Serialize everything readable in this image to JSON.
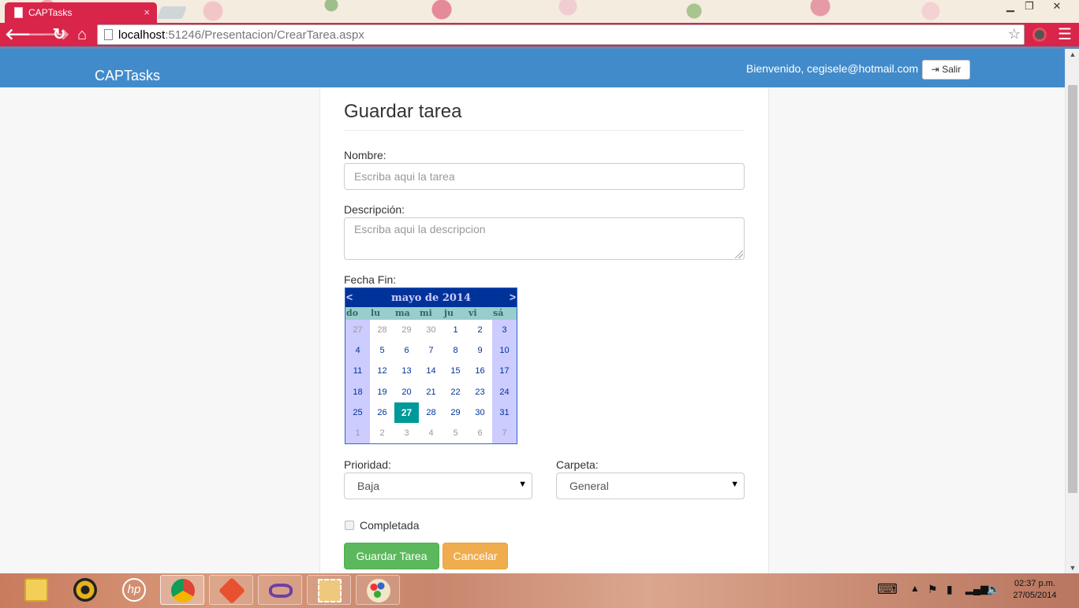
{
  "browser": {
    "tab_title": "CAPTasks",
    "tab_close": "×",
    "url_host": "localhost",
    "url_path": ":51246/Presentacion/CrearTarea.aspx",
    "window_min": "▁",
    "window_max": "❐",
    "window_close": "✕"
  },
  "navbar": {
    "brand": "CAPTasks",
    "welcome": "Bienvenido, cegisele@hotmail.com",
    "logout_label": "Salir"
  },
  "form": {
    "title": "Guardar tarea",
    "nombre_label": "Nombre:",
    "nombre_placeholder": "Escriba aqui la tarea",
    "descripcion_label": "Descripción:",
    "descripcion_placeholder": "Escriba aqui la descripcion",
    "fecha_label": "Fecha Fin:",
    "prioridad_label": "Prioridad:",
    "prioridad_value": "Baja",
    "carpeta_label": "Carpeta:",
    "carpeta_value": "General",
    "completada_label": "Completada",
    "save_label": "Guardar Tarea",
    "cancel_label": "Cancelar"
  },
  "calendar": {
    "title": "mayo de 2014",
    "prev": "<",
    "next": ">",
    "days_of_week": [
      "do",
      "lu",
      "ma",
      "mi",
      "ju",
      "vi",
      "sá"
    ],
    "selected": "27",
    "weeks": [
      [
        {
          "d": "27",
          "o": true
        },
        {
          "d": "28",
          "o": true
        },
        {
          "d": "29",
          "o": true
        },
        {
          "d": "30",
          "o": true
        },
        {
          "d": "1"
        },
        {
          "d": "2"
        },
        {
          "d": "3"
        }
      ],
      [
        {
          "d": "4"
        },
        {
          "d": "5"
        },
        {
          "d": "6"
        },
        {
          "d": "7"
        },
        {
          "d": "8"
        },
        {
          "d": "9"
        },
        {
          "d": "10"
        }
      ],
      [
        {
          "d": "11"
        },
        {
          "d": "12"
        },
        {
          "d": "13"
        },
        {
          "d": "14"
        },
        {
          "d": "15"
        },
        {
          "d": "16"
        },
        {
          "d": "17"
        }
      ],
      [
        {
          "d": "18"
        },
        {
          "d": "19"
        },
        {
          "d": "20"
        },
        {
          "d": "21"
        },
        {
          "d": "22"
        },
        {
          "d": "23"
        },
        {
          "d": "24"
        }
      ],
      [
        {
          "d": "25"
        },
        {
          "d": "26"
        },
        {
          "d": "27",
          "s": true
        },
        {
          "d": "28"
        },
        {
          "d": "29"
        },
        {
          "d": "30"
        },
        {
          "d": "31"
        }
      ],
      [
        {
          "d": "1",
          "o": true
        },
        {
          "d": "2",
          "o": true
        },
        {
          "d": "3",
          "o": true
        },
        {
          "d": "4",
          "o": true
        },
        {
          "d": "5",
          "o": true
        },
        {
          "d": "6",
          "o": true
        },
        {
          "d": "7",
          "o": true
        }
      ]
    ]
  },
  "taskbar": {
    "time": "02:37 p.m.",
    "date": "27/05/2014",
    "hp_label": "hp",
    "apps": [
      "file-explorer",
      "media-player",
      "hp",
      "chrome",
      "git",
      "visual-studio",
      "snipping-tool",
      "paint"
    ]
  }
}
